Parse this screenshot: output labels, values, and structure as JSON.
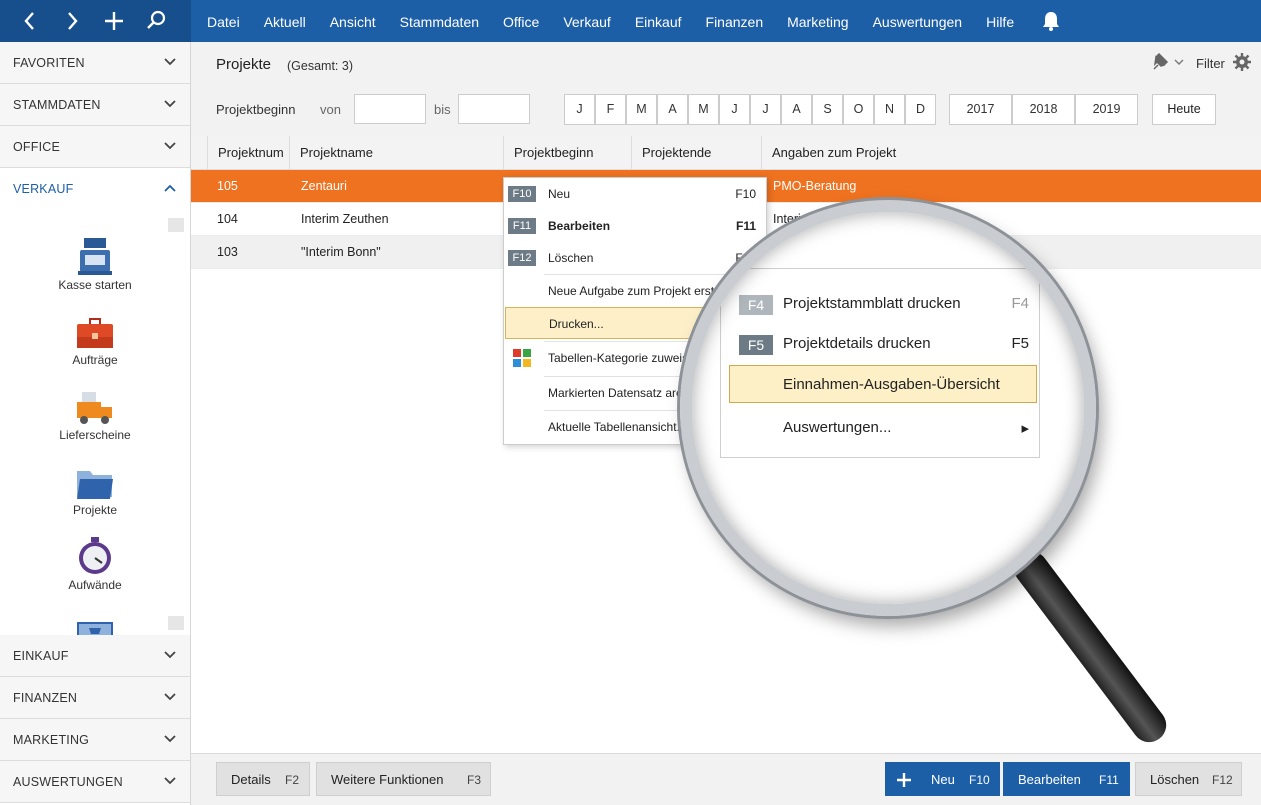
{
  "nav": {
    "back_icon": "chevron-left-icon",
    "forward_icon": "chevron-right-icon",
    "add_icon": "plus-icon",
    "search_icon": "search-icon",
    "menu": [
      "Datei",
      "Aktuell",
      "Ansicht",
      "Stammdaten",
      "Office",
      "Verkauf",
      "Einkauf",
      "Finanzen",
      "Marketing",
      "Auswertungen",
      "Hilfe"
    ],
    "bell_icon": "bell-icon"
  },
  "sidebar": {
    "sections_top": [
      "FAVORITEN",
      "STAMMDATEN",
      "OFFICE"
    ],
    "active_section": "VERKAUF",
    "apps": [
      "Kasse starten",
      "Aufträge",
      "Lieferscheine",
      "Projekte",
      "Aufwände"
    ],
    "sections_bottom": [
      "EINKAUF",
      "FINANZEN",
      "MARKETING",
      "AUSWERTUNGEN"
    ]
  },
  "header": {
    "title": "Projekte",
    "count": "(Gesamt: 3)",
    "filter_label": "Filter"
  },
  "filter": {
    "label": "Projektbeginn",
    "von": "von",
    "bis": "bis",
    "months": [
      "J",
      "F",
      "M",
      "A",
      "M",
      "J",
      "J",
      "A",
      "S",
      "O",
      "N",
      "D"
    ],
    "years": [
      "2017",
      "2018",
      "2019"
    ],
    "today": "Heute"
  },
  "table": {
    "columns": [
      "Projektnum",
      "Projektname",
      "Projektbeginn",
      "Projektende",
      "Angaben zum Projekt"
    ],
    "rows": [
      {
        "nr": "105",
        "name": "Zentauri",
        "info": "PMO-Beratung",
        "selected": true
      },
      {
        "nr": "104",
        "name": "Interim Zeuthen",
        "info": "Interim Zeuth",
        "selected": false
      },
      {
        "nr": "103",
        "name": "\"Interim Bonn\"",
        "info": "",
        "selected": false
      }
    ]
  },
  "context_menu": {
    "items": [
      {
        "key": "F10",
        "label": "Neu",
        "shortcut": "F10"
      },
      {
        "key": "F11",
        "label": "Bearbeiten",
        "shortcut": "F11"
      },
      {
        "key": "F12",
        "label": "Löschen",
        "shortcut": "F12"
      },
      {
        "key": "",
        "label": "Neue Aufgabe zum Projekt erstell",
        "shortcut": ""
      },
      {
        "key": "",
        "label": "Drucken...",
        "shortcut": ""
      },
      {
        "key": "",
        "label": "Tabellen-Kategorie zuweise",
        "shortcut": ""
      },
      {
        "key": "",
        "label": "Markierten Datensatz arch",
        "shortcut": ""
      },
      {
        "key": "",
        "label": "Aktuelle Tabellenansicht...",
        "shortcut": ""
      }
    ]
  },
  "submenu": {
    "items": [
      {
        "key": "F4",
        "label": "Projektstammblatt drucken",
        "shortcut": "F4"
      },
      {
        "key": "F5",
        "label": "Projektdetails drucken",
        "shortcut": "F5"
      },
      {
        "key": "",
        "label": "Einnahmen-Ausgaben-Übersicht",
        "shortcut": ""
      },
      {
        "key": "",
        "label": "Auswertungen...",
        "shortcut": "▸"
      }
    ]
  },
  "bottom": {
    "details": "Details",
    "details_key": "F2",
    "more": "Weitere Funktionen",
    "more_key": "F3",
    "new": "Neu",
    "new_key": "F10",
    "edit": "Bearbeiten",
    "edit_key": "F11",
    "delete": "Löschen",
    "delete_key": "F12"
  }
}
